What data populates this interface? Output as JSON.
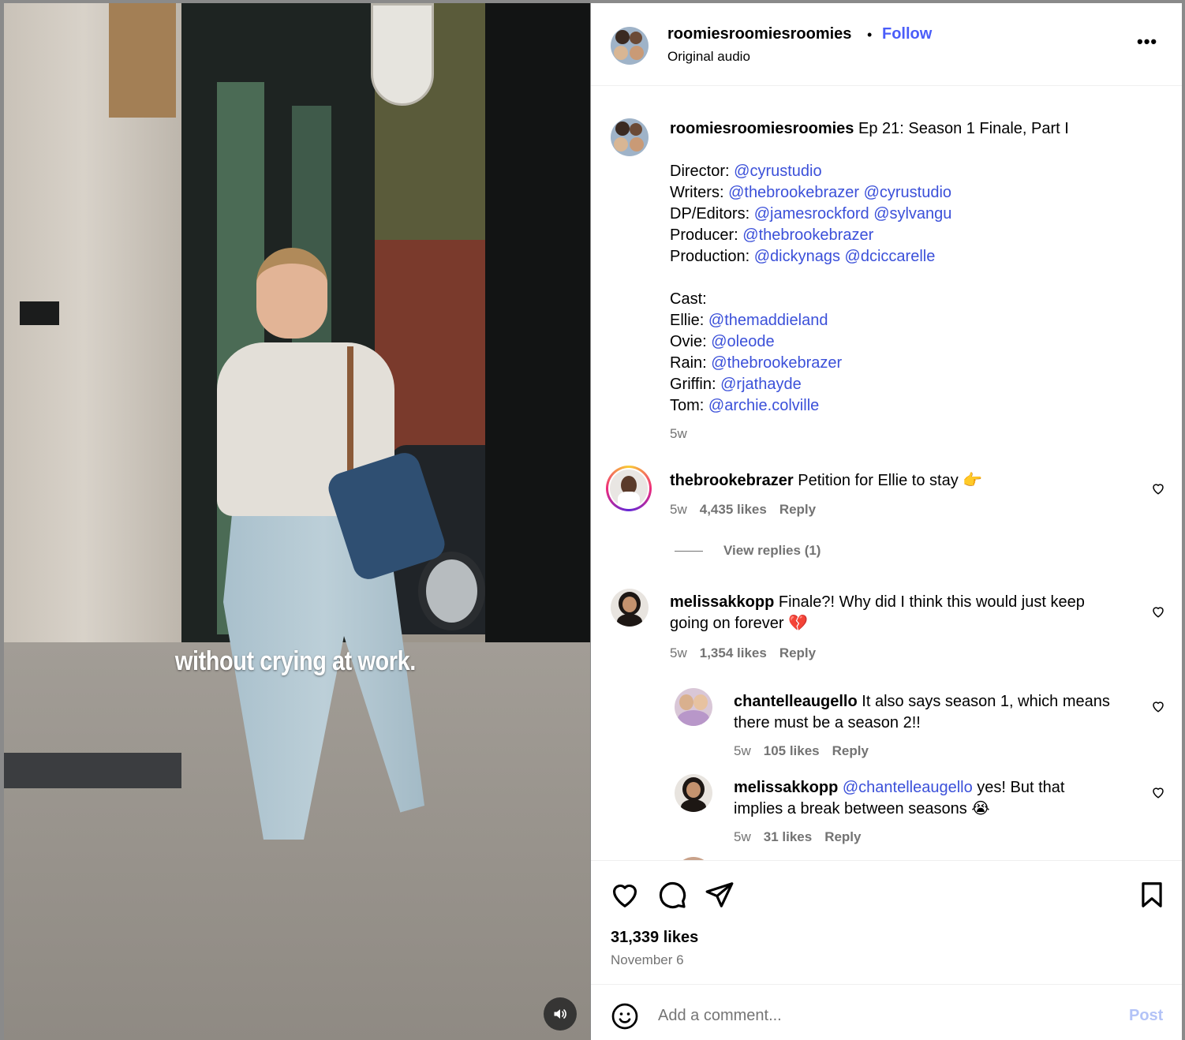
{
  "video": {
    "caption": "without crying at work.",
    "mute_icon": "speaker-icon"
  },
  "header": {
    "username": "roomiesroomiesroomies",
    "separator": "•",
    "follow_label": "Follow",
    "audio_label": "Original audio",
    "more_icon": "more-options-icon",
    "more_label": "•••"
  },
  "post": {
    "username": "roomiesroomiesroomies",
    "title": "Ep 21: Season 1 Finale, Part I",
    "credits": [
      {
        "label": "Director:",
        "mentions": [
          "@cyrustudio"
        ]
      },
      {
        "label": "Writers:",
        "mentions": [
          "@thebrookebrazer",
          "@cyrustudio"
        ]
      },
      {
        "label": "DP/Editors:",
        "mentions": [
          "@jamesrockford",
          "@sylvangu"
        ]
      },
      {
        "label": "Producer:",
        "mentions": [
          "@thebrookebrazer"
        ]
      },
      {
        "label": "Production:",
        "mentions": [
          "@dickynags",
          "@dciccarelle"
        ]
      }
    ],
    "cast_heading": "Cast:",
    "cast": [
      {
        "label": "Ellie:",
        "mention": "@themaddieland"
      },
      {
        "label": "Ovie:",
        "mention": "@oleode"
      },
      {
        "label": "Rain:",
        "mention": "@thebrookebrazer"
      },
      {
        "label": "Griffin:",
        "mention": "@rjathayde"
      },
      {
        "label": "Tom:",
        "mention": "@archie.colville"
      }
    ],
    "time": "5w"
  },
  "comments": [
    {
      "username": "thebrookebrazer",
      "text": "Petition for Ellie to stay 👉",
      "time": "5w",
      "likes": "4,435 likes",
      "reply": "Reply"
    },
    {
      "username": "melissakkopp",
      "text_line1": "Finale?! Why did I think this would just keep",
      "text_line2": "going on forever 💔",
      "time": "5w",
      "likes": "1,354 likes",
      "reply": "Reply"
    },
    {
      "username": "chantelleaugello",
      "text_line1": "It also says season 1, which means",
      "text_line2": "there must be a season 2!!",
      "time": "5w",
      "likes": "105 likes",
      "reply": "Reply"
    },
    {
      "username": "melissakkopp",
      "mention": "@chantelleaugello",
      "text_line1": "yes! But that",
      "text_line2": "implies a break between seasons 😭",
      "time": "5w",
      "likes": "31 likes",
      "reply": "Reply"
    }
  ],
  "view_replies": "View replies (1)",
  "actions": {
    "likes": "31,339 likes",
    "date": "November 6"
  },
  "composer": {
    "placeholder": "Add a comment...",
    "post_label": "Post"
  },
  "colors": {
    "link": "#3b50d9",
    "follow": "#4a5df9",
    "muted": "#737373",
    "post_disabled": "#b3c3f7"
  }
}
